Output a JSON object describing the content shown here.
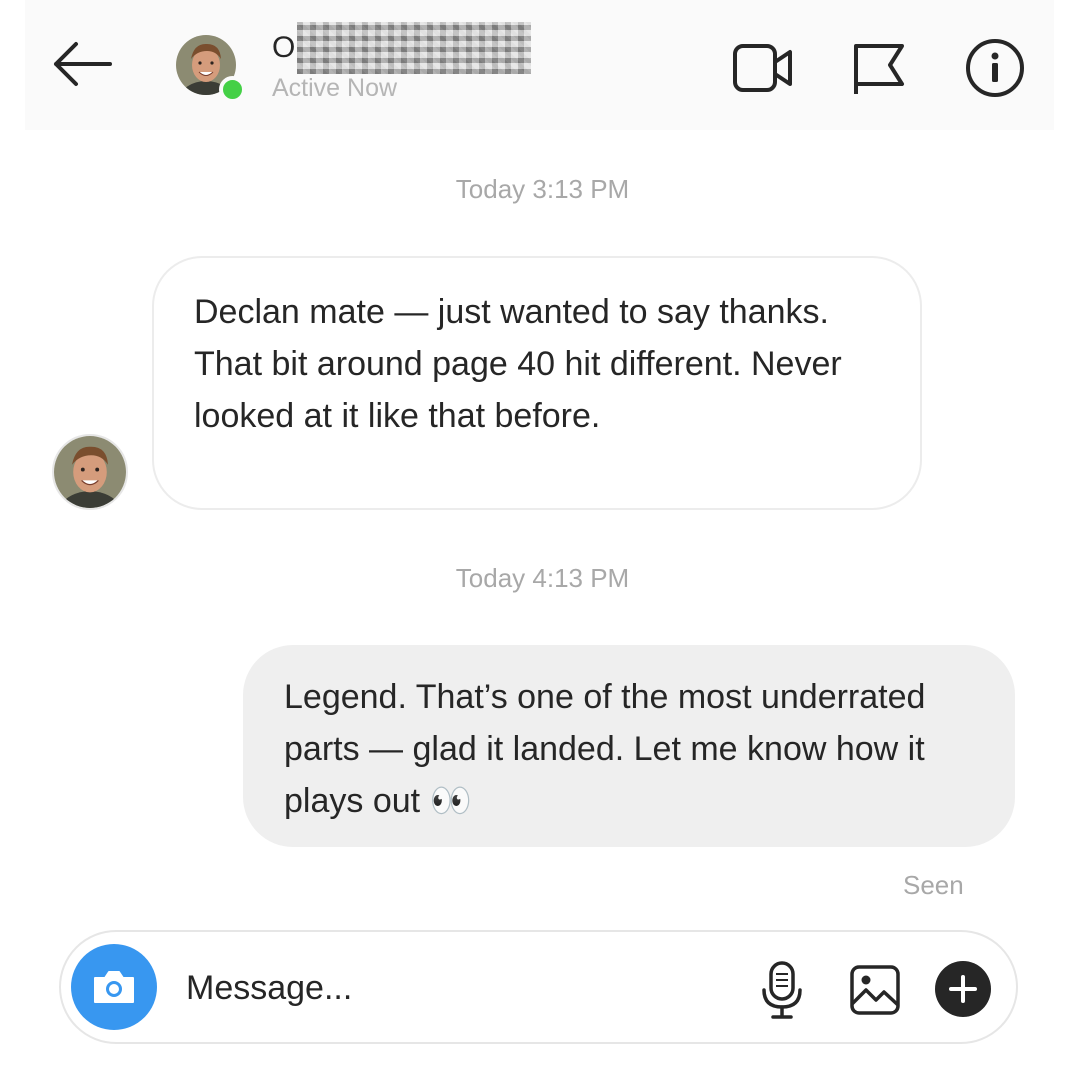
{
  "header": {
    "back_icon": "arrow-left-icon",
    "contact_name_visible": "O",
    "contact_name_redacted": true,
    "status": "Active Now",
    "status_color": "#44d046",
    "actions": [
      {
        "name": "video-call",
        "icon": "video-camera-icon"
      },
      {
        "name": "report",
        "icon": "flag-icon"
      },
      {
        "name": "info",
        "icon": "info-circle-icon"
      }
    ]
  },
  "messages": [
    {
      "timestamp": "Today 3:13 PM",
      "direction": "incoming",
      "text": "Declan mate — just wanted to say thanks. That bit around page 40 hit different. Never looked at it like that before."
    },
    {
      "timestamp": "Today 4:13 PM",
      "direction": "outgoing",
      "text": "Legend. That’s one of the most underrated parts — glad it landed. Let me know how it plays out 👀"
    }
  ],
  "seen_label": "Seen",
  "composer": {
    "placeholder": "Message...",
    "camera_icon": "camera-icon",
    "mic_icon": "microphone-icon",
    "gallery_icon": "image-icon",
    "plus_icon": "plus-circle-icon",
    "camera_color": "#3897f0"
  }
}
